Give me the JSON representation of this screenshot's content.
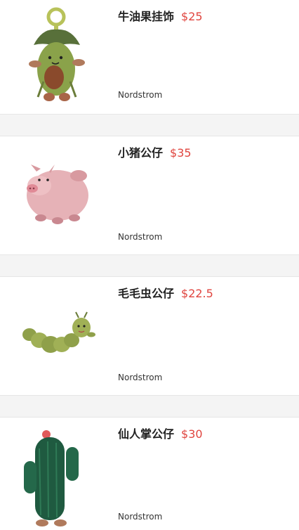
{
  "products": [
    {
      "title": "牛油果挂饰",
      "price": "$25",
      "store": "Nordstrom",
      "icon": "avocado-plush-icon"
    },
    {
      "title": "小猪公仔",
      "price": "$35",
      "store": "Nordstrom",
      "icon": "pig-plush-icon"
    },
    {
      "title": "毛毛虫公仔",
      "price": "$22.5",
      "store": "Nordstrom",
      "icon": "caterpillar-plush-icon"
    },
    {
      "title": "仙人掌公仔",
      "price": "$30",
      "store": "Nordstrom",
      "icon": "cactus-plush-icon"
    }
  ],
  "colors": {
    "price": "#e0453f",
    "title": "#222222",
    "store": "#333333",
    "divider": "#e6e6e6",
    "gap": "#f4f4f4"
  }
}
